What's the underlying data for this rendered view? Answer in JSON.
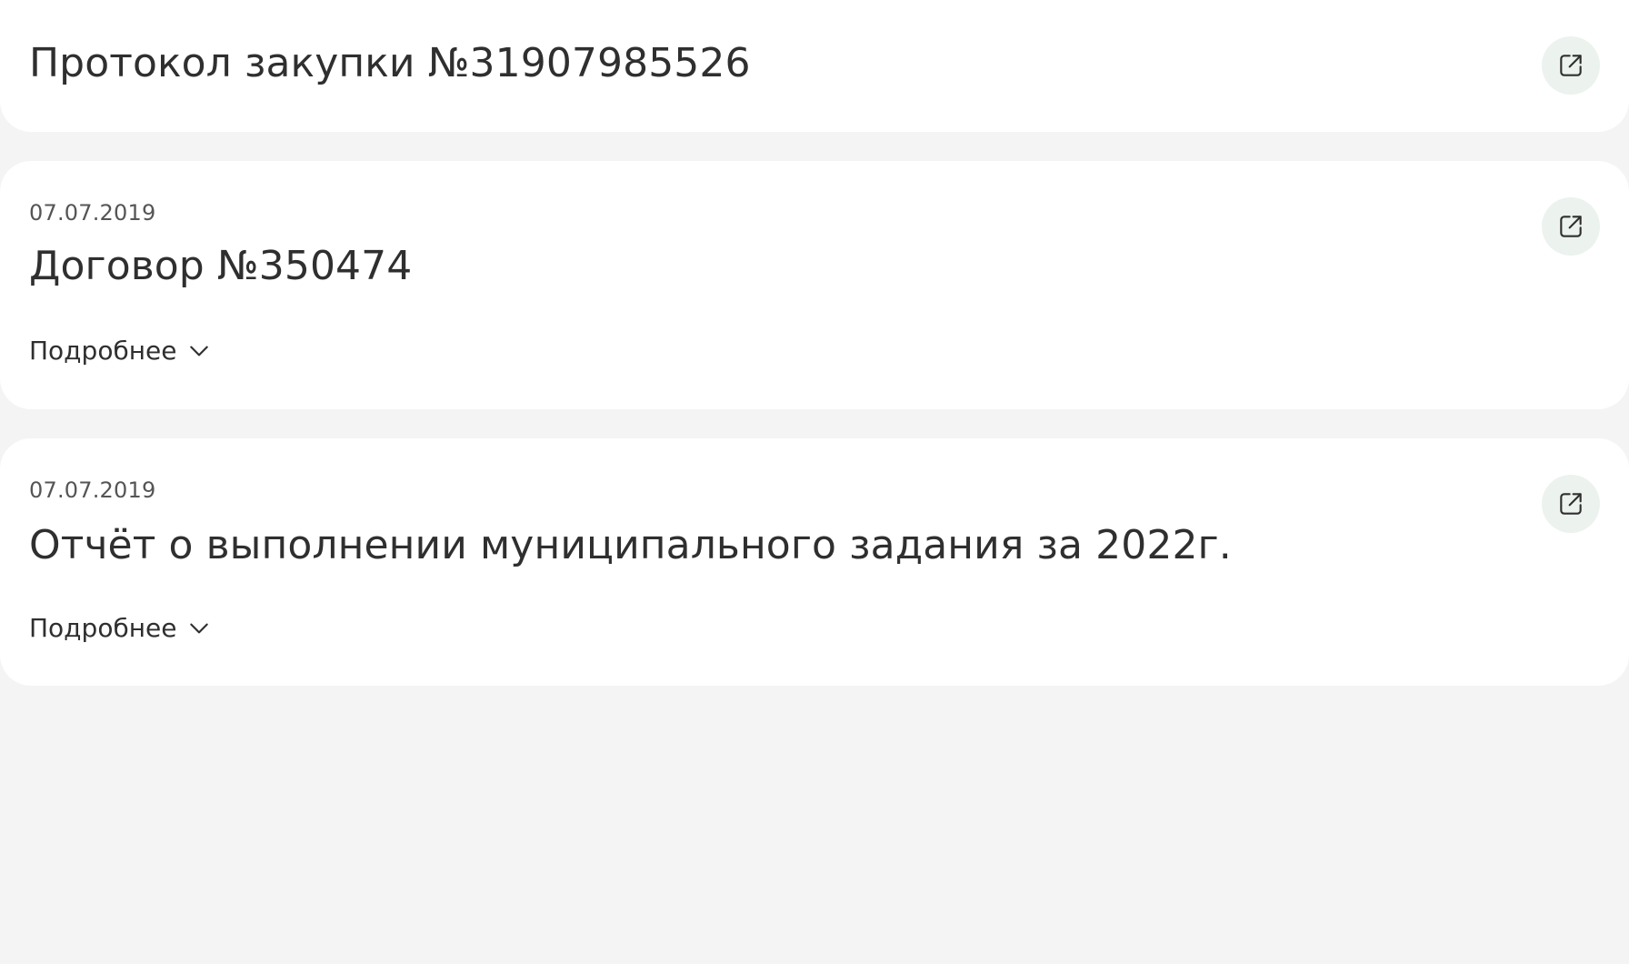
{
  "documents": [
    {
      "date": "",
      "title": "Протокол закупки №31907985526",
      "more_label": "",
      "open_icon": "external-link-icon"
    },
    {
      "date": "07.07.2019",
      "title": "Договор №350474",
      "more_label": "Подробнее",
      "open_icon": "external-link-icon"
    },
    {
      "date": "07.07.2019",
      "title": "Отчёт о выполнении муниципального задания за 2022г.",
      "more_label": "Подробнее",
      "open_icon": "external-link-icon"
    }
  ],
  "colors": {
    "background": "#f4f4f4",
    "card": "#ffffff",
    "text": "#2f2f2f",
    "muted_text": "#555555",
    "icon_button_bg": "#ecf2ee"
  }
}
